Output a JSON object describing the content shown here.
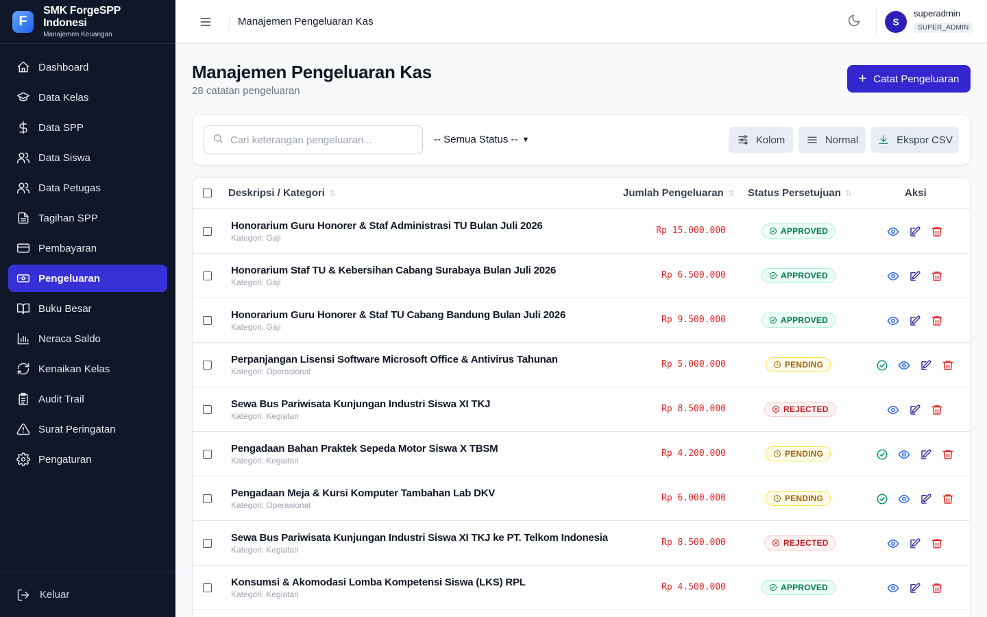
{
  "brand": {
    "logo_letter": "F",
    "name": "SMK ForgeSPP Indonesi",
    "subtitle": "Manajemen Keuangan"
  },
  "sidebar": {
    "items": [
      {
        "label": "Dashboard",
        "icon": "home-icon"
      },
      {
        "label": "Data Kelas",
        "icon": "graduation-cap-icon"
      },
      {
        "label": "Data SPP",
        "icon": "dollar-icon"
      },
      {
        "label": "Data Siswa",
        "icon": "users-icon"
      },
      {
        "label": "Data Petugas",
        "icon": "users-icon"
      },
      {
        "label": "Tagihan SPP",
        "icon": "file-text-icon"
      },
      {
        "label": "Pembayaran",
        "icon": "credit-card-icon"
      },
      {
        "label": "Pengeluaran",
        "icon": "banknote-icon",
        "active": true
      },
      {
        "label": "Buku Besar",
        "icon": "book-open-icon"
      },
      {
        "label": "Neraca Saldo",
        "icon": "bar-chart-icon"
      },
      {
        "label": "Kenaikan Kelas",
        "icon": "refresh-icon"
      },
      {
        "label": "Audit Trail",
        "icon": "clipboard-list-icon"
      },
      {
        "label": "Surat Peringatan",
        "icon": "alert-triangle-icon"
      },
      {
        "label": "Pengaturan",
        "icon": "gear-icon"
      }
    ],
    "logout_label": "Keluar"
  },
  "topbar": {
    "title": "Manajemen Pengeluaran Kas",
    "user": {
      "initial": "S",
      "name": "superadmin",
      "role": "SUPER_ADMIN"
    }
  },
  "page": {
    "title": "Manajemen Pengeluaran Kas",
    "subtitle": "28 catatan pengeluaran",
    "add_button": "Catat Pengeluaran"
  },
  "toolbar": {
    "search_placeholder": "Cari keterangan pengeluaran...",
    "status_filter": "-- Semua Status --",
    "columns_button": "Kolom",
    "density_button": "Normal",
    "export_button": "Ekspor CSV"
  },
  "table": {
    "headers": {
      "description": "Deskripsi / Kategori",
      "amount": "Jumlah Pengeluaran",
      "status": "Status Persetujuan",
      "actions": "Aksi"
    },
    "rows": [
      {
        "description": "Honorarium Guru Honorer & Staf Administrasi TU Bulan Juli 2026",
        "category": "Kategori: Gaji",
        "amount": "Rp 15.000.000",
        "status": "APPROVED"
      },
      {
        "description": "Honorarium Staf TU & Kebersihan Cabang Surabaya Bulan Juli 2026",
        "category": "Kategori: Gaji",
        "amount": "Rp 6.500.000",
        "status": "APPROVED"
      },
      {
        "description": "Honorarium Guru Honorer & Staf TU Cabang Bandung Bulan Juli 2026",
        "category": "Kategori: Gaji",
        "amount": "Rp 9.500.000",
        "status": "APPROVED"
      },
      {
        "description": "Perpanjangan Lisensi Software Microsoft Office & Antivirus Tahunan",
        "category": "Kategori: Operasional",
        "amount": "Rp 5.000.000",
        "status": "PENDING"
      },
      {
        "description": "Sewa Bus Pariwisata Kunjungan Industri Siswa XI TKJ",
        "category": "Kategori: Kegiatan",
        "amount": "Rp 8.500.000",
        "status": "REJECTED"
      },
      {
        "description": "Pengadaan Bahan Praktek Sepeda Motor Siswa X TBSM",
        "category": "Kategori: Kegiatan",
        "amount": "Rp 4.200.000",
        "status": "PENDING"
      },
      {
        "description": "Pengadaan Meja & Kursi Komputer Tambahan Lab DKV",
        "category": "Kategori: Operasional",
        "amount": "Rp 6.000.000",
        "status": "PENDING"
      },
      {
        "description": "Sewa Bus Pariwisata Kunjungan Industri Siswa XI TKJ ke PT. Telkom Indonesia",
        "category": "Kategori: Kegiatan",
        "amount": "Rp 8.500.000",
        "status": "REJECTED"
      },
      {
        "description": "Konsumsi & Akomodasi Lomba Kompetensi Siswa (LKS) RPL",
        "category": "Kategori: Kegiatan",
        "amount": "Rp 4.500.000",
        "status": "APPROVED"
      }
    ]
  },
  "colors": {
    "sidebar_bg": "#0f1729",
    "accent": "#3427d0",
    "amount_red": "#dc2626"
  }
}
